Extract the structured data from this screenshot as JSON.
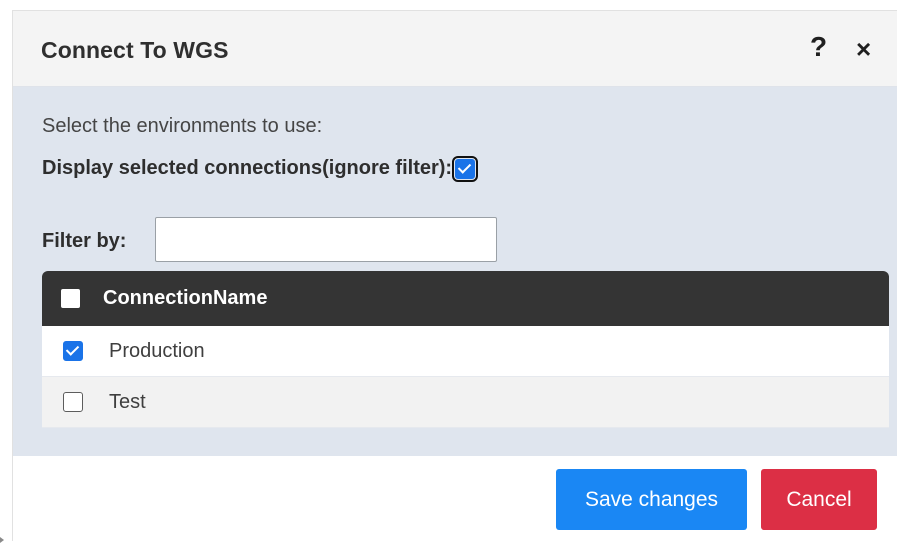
{
  "dialog": {
    "title": "Connect To WGS",
    "help_icon": "?",
    "close_icon": "×"
  },
  "body": {
    "intro": "Select the environments to use:",
    "display_selected_label": "Display selected connections(ignore filter):",
    "display_selected_checked": true,
    "filter_label": "Filter by:",
    "filter_value": "",
    "filter_placeholder": ""
  },
  "grid": {
    "header": {
      "select_all_checked": false,
      "column": "ConnectionName"
    },
    "rows": [
      {
        "name": "Production",
        "checked": true
      },
      {
        "name": "Test",
        "checked": false
      }
    ]
  },
  "footer": {
    "save_label": "Save changes",
    "cancel_label": "Cancel"
  },
  "colors": {
    "body_background": "#dfe5ee",
    "grid_header": "#343434",
    "save_button": "#1a87f4",
    "cancel_button": "#dc2f45",
    "checkbox_checked": "#1a73e8"
  }
}
